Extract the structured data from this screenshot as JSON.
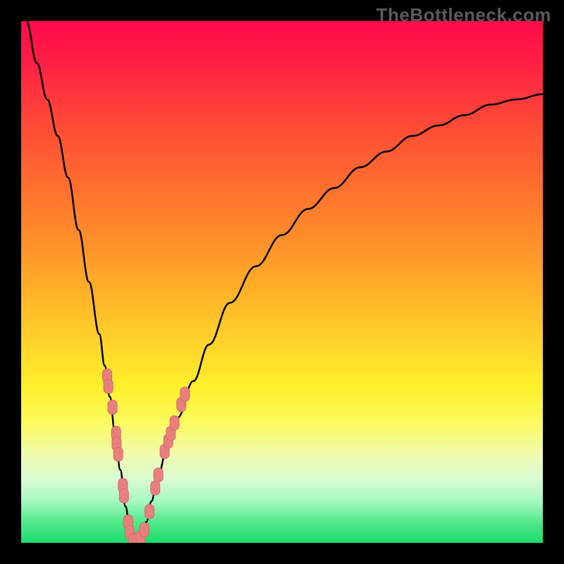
{
  "watermark": "TheBottleneck.com",
  "colors": {
    "curve": "#000000",
    "marker_fill": "#e9807e",
    "marker_stroke": "#d46866"
  },
  "chart_data": {
    "type": "line",
    "title": "",
    "xlabel": "",
    "ylabel": "",
    "xlim": [
      0,
      100
    ],
    "ylim": [
      0,
      100
    ],
    "grid": false,
    "series": [
      {
        "name": "bottleneck-curve",
        "x": [
          1,
          3,
          5,
          7,
          9,
          11,
          13,
          15,
          16,
          17,
          18,
          19,
          20,
          21,
          22,
          23,
          24,
          25,
          26,
          28,
          30,
          33,
          36,
          40,
          45,
          50,
          55,
          60,
          65,
          70,
          75,
          80,
          85,
          90,
          95,
          100
        ],
        "y": [
          100,
          92,
          85,
          78,
          70,
          60,
          50,
          40,
          34,
          28,
          21,
          14,
          7,
          1,
          0,
          1,
          4,
          8,
          12,
          18,
          24,
          31,
          38,
          46,
          53,
          59,
          64,
          68,
          72,
          75,
          78,
          80,
          82,
          84,
          85,
          86
        ]
      }
    ],
    "markers": {
      "name": "scatter-points",
      "points": [
        {
          "x": 16.5,
          "y": 32
        },
        {
          "x": 16.7,
          "y": 30
        },
        {
          "x": 17.5,
          "y": 26
        },
        {
          "x": 18.2,
          "y": 21
        },
        {
          "x": 18.3,
          "y": 19
        },
        {
          "x": 18.6,
          "y": 17
        },
        {
          "x": 19.5,
          "y": 11
        },
        {
          "x": 19.7,
          "y": 9
        },
        {
          "x": 20.5,
          "y": 4
        },
        {
          "x": 20.8,
          "y": 2
        },
        {
          "x": 21.5,
          "y": 0.5
        },
        {
          "x": 22.2,
          "y": 0.5
        },
        {
          "x": 22.9,
          "y": 1
        },
        {
          "x": 23.6,
          "y": 2.5
        },
        {
          "x": 24.6,
          "y": 6
        },
        {
          "x": 25.7,
          "y": 10.5
        },
        {
          "x": 26.3,
          "y": 13
        },
        {
          "x": 27.5,
          "y": 17.5
        },
        {
          "x": 28.2,
          "y": 19.5
        },
        {
          "x": 28.7,
          "y": 21
        },
        {
          "x": 29.4,
          "y": 23
        },
        {
          "x": 30.7,
          "y": 26.5
        },
        {
          "x": 31.4,
          "y": 28.5
        }
      ]
    }
  }
}
